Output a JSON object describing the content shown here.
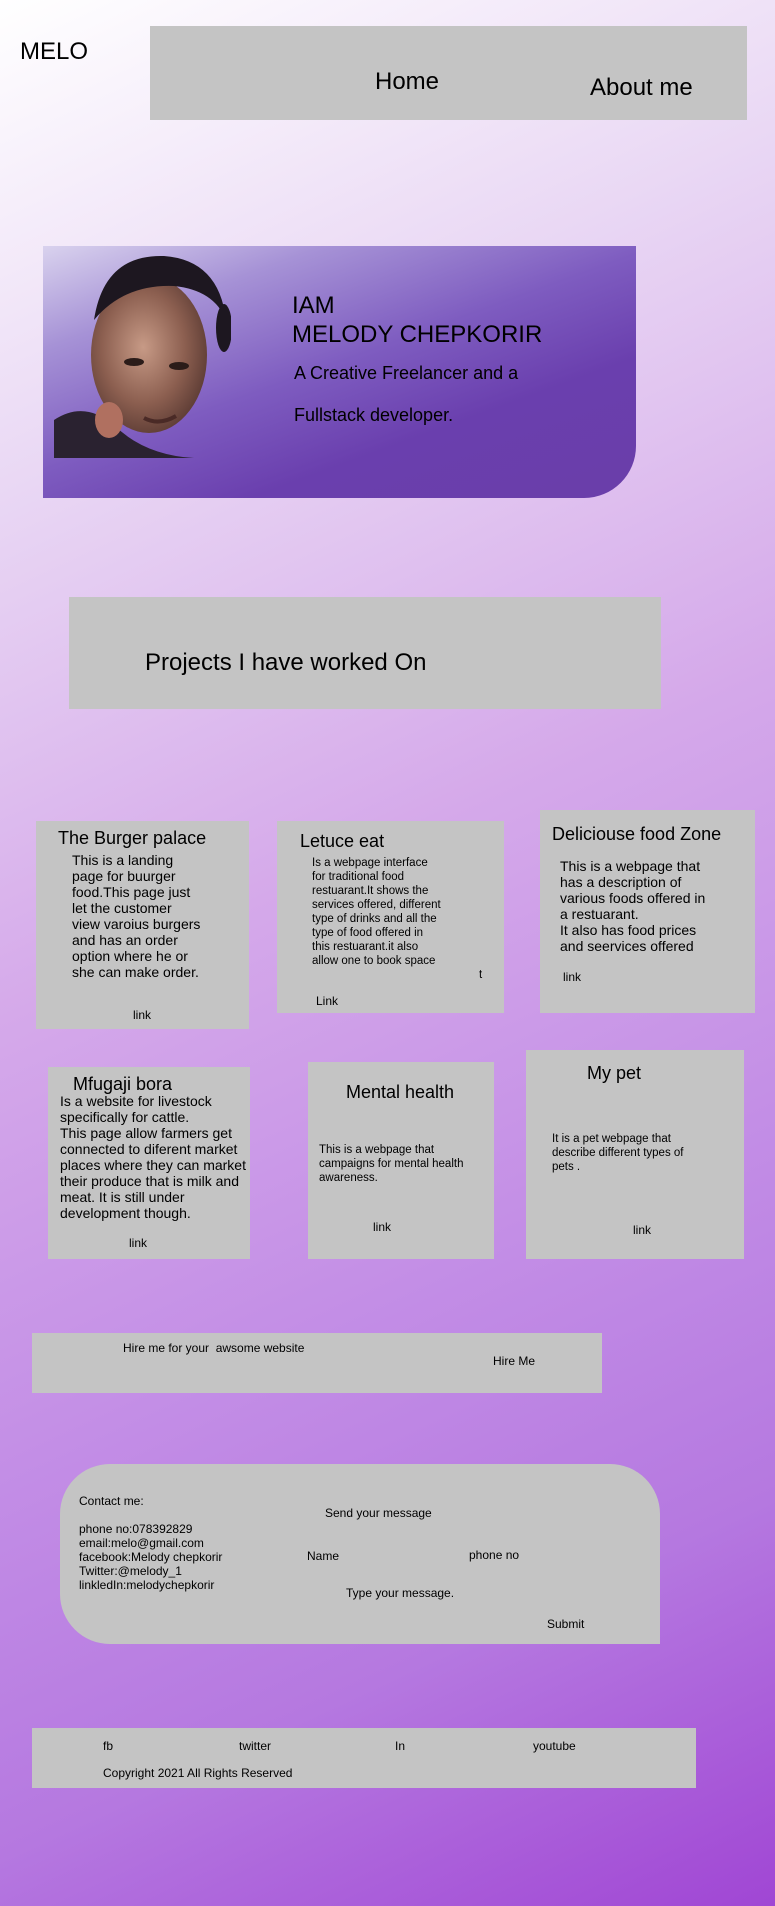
{
  "logo": "MELO",
  "nav": {
    "home": "Home",
    "about": "About me"
  },
  "hero": {
    "line1": "IAM",
    "line2": "MELODY CHEPKORIR",
    "tagline1": "A Creative Freelancer and a",
    "tagline2": "Fullstack developer."
  },
  "projects": {
    "heading": "Projects I have worked On",
    "items": [
      {
        "title": "The Burger palace",
        "description": "This is a landing page for buurger food.This page just let the customer view varoius burgers and has an order option where he or she can make order.",
        "link": "link"
      },
      {
        "title": "Letuce eat",
        "description": "Is a webpage interface for traditional food restuarant.It shows the services offered, different type of drinks and all the type of food offered in this restuarant.it also allow one to book space",
        "extra": "t",
        "link": "Link"
      },
      {
        "title": "Deliciouse food Zone",
        "description": "This is a webpage that has a description of various foods offered in a restuarant.",
        "description2": "It also has food prices and seervices offered",
        "link": "link"
      },
      {
        "title": "Mfugaji bora",
        "description": "Is a website for livestock specifically for cattle.",
        "description2": "This page allow farmers get connected to diferent market places where they can market their produce that is milk and meat. It is still under development though.",
        "link": "link"
      },
      {
        "title": "Mental health",
        "description": "This is a webpage that campaigns for mental health awareness.",
        "link": "link"
      },
      {
        "title": "My pet",
        "description": "It is a pet webpage that describe different types of pets .",
        "link": "link"
      }
    ]
  },
  "hire": {
    "text": "Hire me for your  awsome website",
    "button": "Hire Me"
  },
  "contact": {
    "heading": "Contact me:",
    "phone": "phone no:078392829",
    "email": "email:melo@gmail.com",
    "facebook": "facebook:Melody chepkorir",
    "twitter": "Twitter:@melody_1",
    "linkedin": "linkledIn:melodychepkorir",
    "send_label": "Send your message",
    "name_placeholder": "Name",
    "phone_placeholder": "phone no",
    "message_placeholder": "Type your message.",
    "submit": "Submit"
  },
  "footer": {
    "links": [
      "fb",
      "twitter",
      "In",
      "youtube"
    ],
    "copyright": "Copyright 2021 All Rights Reserved"
  }
}
